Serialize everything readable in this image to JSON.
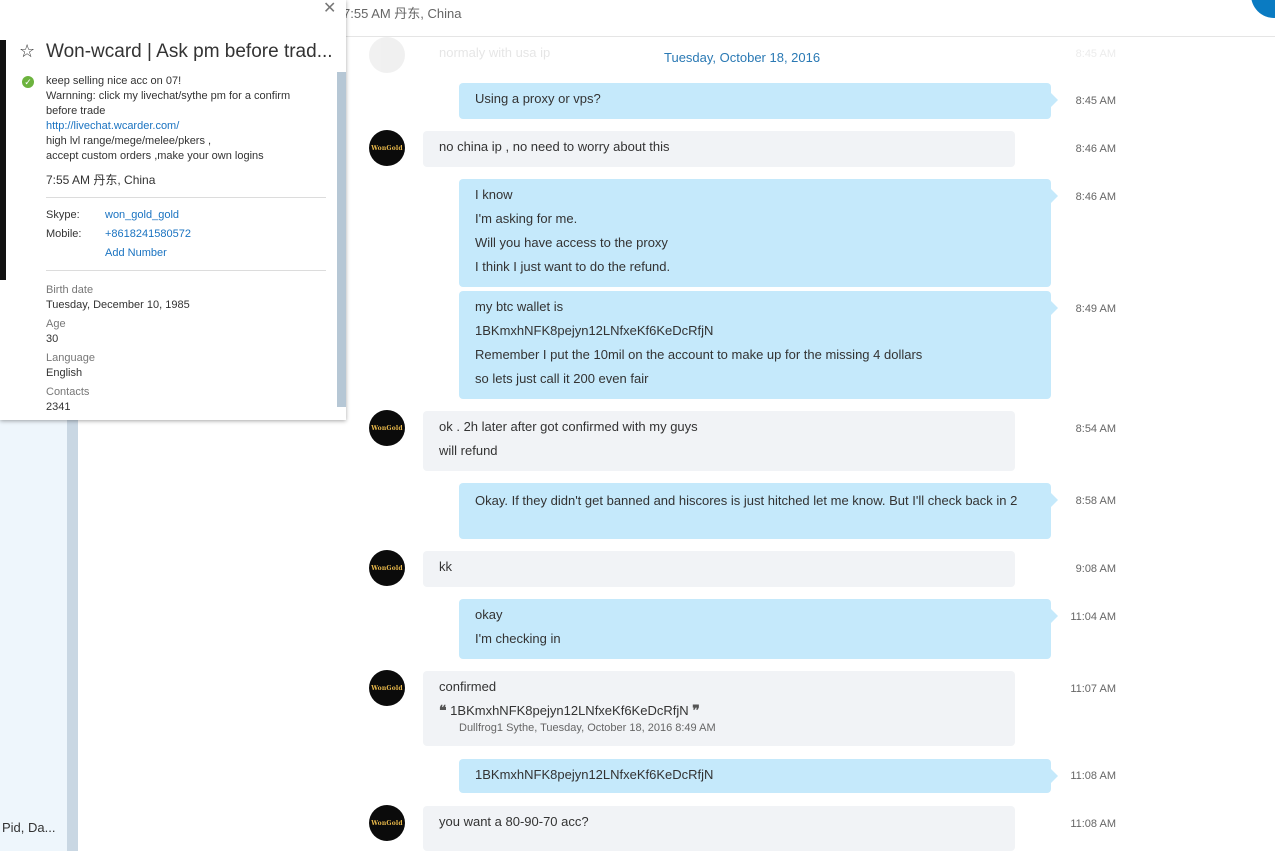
{
  "header": {
    "status_text": "7:55 AM 丹东, China"
  },
  "sidebar": {
    "recent_label": "Pid, Da..."
  },
  "chat": {
    "date_separator": "Tuesday, October 18, 2016",
    "faded_text": "normaly with usa ip",
    "faded_time": "8:45 AM",
    "avatar_text": "WonGold",
    "messages": [
      {
        "dir": "out",
        "lines": [
          "Using a proxy or vps?"
        ],
        "time": "8:45 AM"
      },
      {
        "dir": "in",
        "lines": [
          "no china ip ,  no need to worry about this"
        ],
        "time": "8:46 AM"
      },
      {
        "dir": "out",
        "lines": [
          "I know",
          "I'm asking for me.",
          "Will you have access to the proxy",
          "I think I just want to do the refund."
        ],
        "time": "8:46 AM"
      },
      {
        "dir": "out",
        "lines": [
          "my btc wallet is",
          "1BKmxhNFK8pejyn12LNfxeKf6KeDcRfjN",
          "Remember I put the 10mil on the account to make up for the missing 4 dollars",
          "so lets just call it 200 even fair"
        ],
        "time": "8:49 AM"
      },
      {
        "dir": "in",
        "lines": [
          "ok . 2h later after got confirmed with my guys",
          "will refund"
        ],
        "time": "8:54 AM"
      },
      {
        "dir": "out",
        "lines": [
          "Okay. If they didn't get banned and hiscores is just hitched let me know. But I'll check back in 2"
        ],
        "time": "8:58 AM"
      },
      {
        "dir": "in",
        "lines": [
          "kk"
        ],
        "time": "9:08 AM"
      },
      {
        "dir": "out",
        "lines": [
          "okay",
          "I'm checking in"
        ],
        "time": "11:04 AM"
      },
      {
        "dir": "in",
        "lines": [
          "confirmed"
        ],
        "time": "11:07 AM",
        "quote": {
          "open": "❝",
          "text": "1BKmxhNFK8pejyn12LNfxeKf6KeDcRfjN",
          "close": "❞",
          "meta": "Dullfrog1 Sythe, Tuesday, October 18, 2016 8:49 AM"
        }
      },
      {
        "dir": "out",
        "lines": [
          "1BKmxhNFK8pejyn12LNfxeKf6KeDcRfjN"
        ],
        "time": "11:08 AM"
      },
      {
        "dir": "in",
        "lines": [
          "you want a 80-90-70 acc?"
        ],
        "time": "11:08 AM"
      }
    ]
  },
  "popup": {
    "close_glyph": "✕",
    "star_glyph": "☆",
    "name": "Won-wcard | Ask pm before trad...",
    "check_glyph": "✓",
    "mood_lines": [
      "keep selling nice acc on 07!",
      "Warnning: click my livechat/sythe pm for a confirm",
      "before trade"
    ],
    "mood_link": "http://livechat.wcarder.com/",
    "mood_lines_after": [
      "high lvl range/mege/melee/pkers ,",
      "accept custom orders ,make your own logins"
    ],
    "local_time": "7:55 AM 丹东, China",
    "skype_label": "Skype:",
    "skype_value": "won_gold_gold",
    "mobile_label": "Mobile:",
    "mobile_value": "+8618241580572",
    "add_number_label": "Add Number",
    "birth_label": "Birth date",
    "birth_value": "Tuesday, December 10, 1985",
    "age_label": "Age",
    "age_value": "30",
    "language_label": "Language",
    "language_value": "English",
    "contacts_label": "Contacts",
    "contacts_value": "2341"
  },
  "colors": {
    "incoming_bubble": "#f1f3f6",
    "outgoing_bubble": "#c5e9fb",
    "link": "#1a73c1",
    "accent": "#0a7bc2"
  }
}
